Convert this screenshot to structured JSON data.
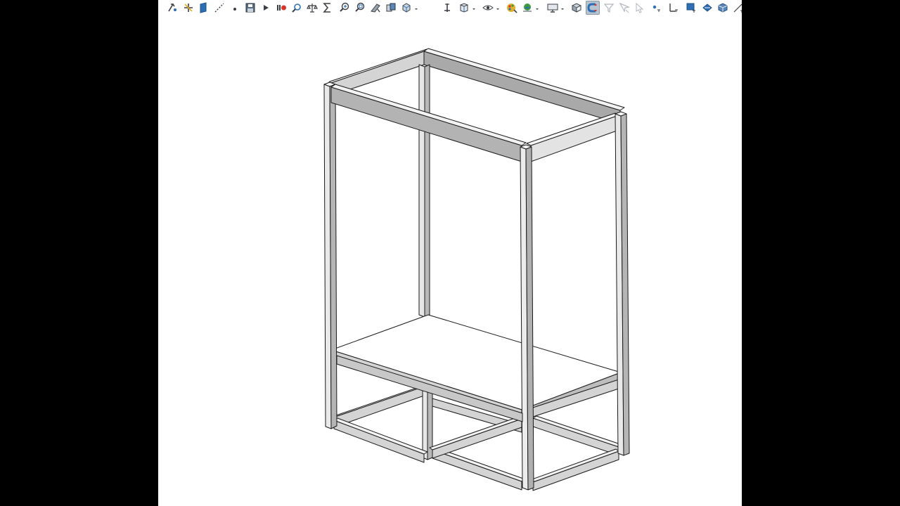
{
  "colors": {
    "background_outer": "#000000",
    "viewport": "#ffffff",
    "toolbar_icon": "#3b3f44",
    "toolbar_accent_blue": "#2d6fb5",
    "toolbar_accent_red": "#d9342b",
    "toolbar_accent_yellow": "#e1b12c",
    "toolbar_accent_green": "#3d9a3d",
    "toolbar_active_bg": "#b7c3cf",
    "frame_face_light": "#f2f2f2",
    "frame_face_mid": "#d4d4d4",
    "frame_face_dark": "#a9a9a9",
    "frame_edge": "#1a1a1a",
    "platform_top": "#ffffff"
  },
  "toolbar": {
    "icons": [
      "sketch-pointer-icon",
      "smart-dimension-icon",
      "sheet-icon",
      "centerline-icon",
      "dot-icon",
      "save-macro-icon",
      "play-icon",
      "pause-record-icon",
      "inspect-icon",
      "balance-icon",
      "sum-icon",
      "zoom-to-fit-icon",
      "zoom-area-icon",
      "previous-view-icon",
      "section-view-icon",
      "view-orientation-icon",
      "move-down-icon",
      "display-style-icon",
      "hide-show-icon",
      "appearance-icon",
      "scene-icon",
      "monitor-icon",
      "realview-icon",
      "magnet-icon",
      "filter-icon",
      "select-filter-icon",
      "cursor-filter-icon",
      "point-icon",
      "axis-icon",
      "plane-icon",
      "rotate-icon",
      "cube-icon",
      "line-tool-icon"
    ]
  }
}
